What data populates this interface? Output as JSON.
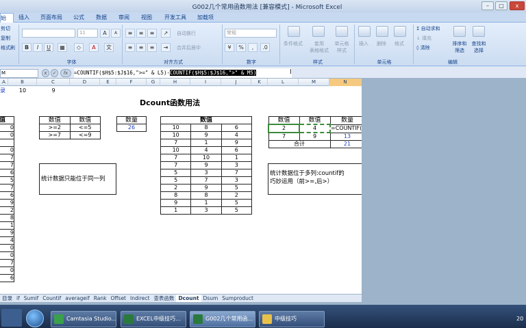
{
  "window": {
    "title": "G002几个常用函数用法 [兼容模式] - Microsoft Excel",
    "buttons": {
      "minimize": "–",
      "maximize": "□",
      "close": "x"
    }
  },
  "ribbon_tabs": [
    "始",
    "插入",
    "页面布局",
    "公式",
    "数据",
    "审阅",
    "视图",
    "开发工具",
    "加载项"
  ],
  "ribbon": {
    "clipboard": {
      "cut": "剪切",
      "copy": "复制",
      "format_painter": "格式刷"
    },
    "font": {
      "name": "",
      "size": "11",
      "grow": "A",
      "shrink": "A",
      "bold": "B",
      "italic": "I",
      "underline": "U",
      "label": "字体"
    },
    "alignment": {
      "wrap": "自动换行",
      "merge": "合并后居中",
      "label": "对齐方式"
    },
    "number": {
      "format": "常规",
      "label": "数字"
    },
    "styles": {
      "conditional": "条件格式",
      "table": "套用\n表格格式",
      "cell": "单元格\n样式",
      "label": "样式"
    },
    "cells": {
      "insert": "插入",
      "delete": "删除",
      "format": "格式",
      "label": "单元格"
    },
    "editing": {
      "autosum": "自动求和",
      "fill": "填充",
      "clear": "清除",
      "sort": "排序和\n筛选",
      "find": "查找和\n选择",
      "label": "编辑"
    }
  },
  "formula_bar": {
    "name_box": "M",
    "fx_cancel": "x",
    "fx_enter": "✓",
    "fx": "fx",
    "formula_main": "=COUNTIF($H$5:$J$16,\">=\" & L5)-",
    "formula_selected": "COUNTIF($H$5:$J$16,\">\" & M5)"
  },
  "columns": [
    "A",
    "B",
    "C",
    "D",
    "E",
    "F",
    "G",
    "H",
    "I",
    "J",
    "K",
    "L",
    "M",
    "N"
  ],
  "sheet": {
    "row1": {
      "a": "录",
      "b": "10",
      "c": "9"
    },
    "title": "Dcount函数用法",
    "col_a_header": "值",
    "col_a_values": [
      "0",
      "0",
      "",
      "0",
      "7",
      "7",
      "6",
      "5",
      "7",
      "6",
      "9",
      "2",
      "8",
      "1",
      "9",
      "4",
      "0",
      "0",
      "7",
      "0",
      "6"
    ],
    "criteria": {
      "headers": [
        "数值",
        "数值"
      ],
      "rows": [
        [
          ">=2",
          "<=5"
        ],
        [
          ">=7",
          "<=9"
        ]
      ]
    },
    "count": {
      "header": "数量",
      "value": "26"
    },
    "data": {
      "header": "数值",
      "rows": [
        [
          "10",
          "8",
          "6"
        ],
        [
          "10",
          "9",
          "4"
        ],
        [
          "7",
          "1",
          "9"
        ],
        [
          "10",
          "4",
          "6"
        ],
        [
          "7",
          "10",
          "1"
        ],
        [
          "7",
          "9",
          "3"
        ],
        [
          "5",
          "3",
          "7"
        ],
        [
          "5",
          "7",
          "3"
        ],
        [
          "2",
          "9",
          "5"
        ],
        [
          "8",
          "8",
          "2"
        ],
        [
          "9",
          "1",
          "5"
        ],
        [
          "1",
          "3",
          "5"
        ]
      ]
    },
    "note1": "统计数据只能位于同一列",
    "result": {
      "headers": [
        "数值",
        "数值",
        "数量"
      ],
      "rows": [
        [
          "2",
          "4",
          "=COUNTIF("
        ],
        [
          "7",
          "9",
          "13"
        ]
      ],
      "total_label": "合计",
      "total_value": "21"
    },
    "note2_line1": "统计数据位于多列:countif的",
    "note2_line2": "巧妙运用（前>=,后>）"
  },
  "sheet_tabs": [
    "目录",
    "if",
    "Sumif",
    "Countif",
    "averageif",
    "Rank",
    "Offset",
    "Indirect",
    "查表函数",
    "Dcount",
    "Dsum",
    "Sumproduct"
  ],
  "active_sheet": "Dcount",
  "taskbar": {
    "items": [
      "Camtasia Studio...",
      "EXCEL中级技巧...",
      "G002几个常用函...",
      "中级技巧"
    ],
    "clock": "20"
  }
}
